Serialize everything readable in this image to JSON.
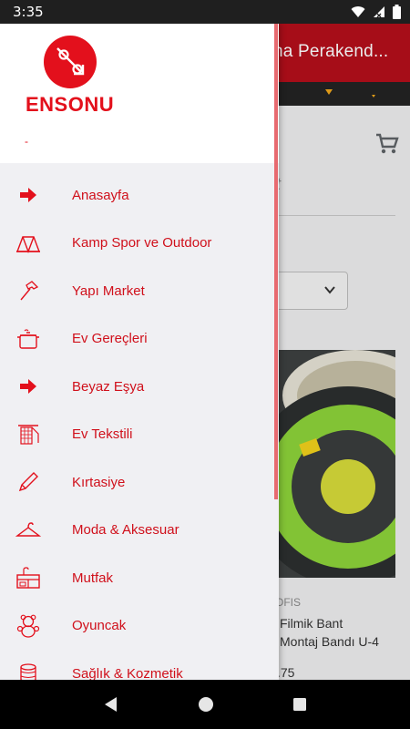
{
  "status_bar": {
    "time": "3:35"
  },
  "background_app": {
    "title": "na Perakend...",
    "search_placeholder": "t",
    "product": {
      "brand": "OFIS",
      "name_line1": "Filmik Bant",
      "name_line2": "Montaj Bandı U-4",
      "price": ".75"
    }
  },
  "drawer": {
    "brand_name": "ENSONU",
    "header_dash": "-",
    "items": [
      {
        "label": "Anasayfa",
        "icon": "arrow-right-icon"
      },
      {
        "label": "Kamp Spor ve Outdoor",
        "icon": "tent-icon"
      },
      {
        "label": "Yapı Market",
        "icon": "hammer-icon"
      },
      {
        "label": "Ev Gereçleri",
        "icon": "pot-icon"
      },
      {
        "label": "Beyaz Eşya",
        "icon": "arrow-right-icon"
      },
      {
        "label": "Ev Tekstili",
        "icon": "textile-icon"
      },
      {
        "label": "Kırtasiye",
        "icon": "pencil-icon"
      },
      {
        "label": "Moda & Aksesuar",
        "icon": "hanger-icon"
      },
      {
        "label": "Mutfak",
        "icon": "kitchen-icon"
      },
      {
        "label": "Oyuncak",
        "icon": "teddy-bear-icon"
      },
      {
        "label": "Sağlık & Kozmetik",
        "icon": "cosmetics-icon"
      }
    ]
  },
  "colors": {
    "brand_red": "#e3101c",
    "menu_text": "#d0101b",
    "toolbar": "#b50f1b"
  }
}
